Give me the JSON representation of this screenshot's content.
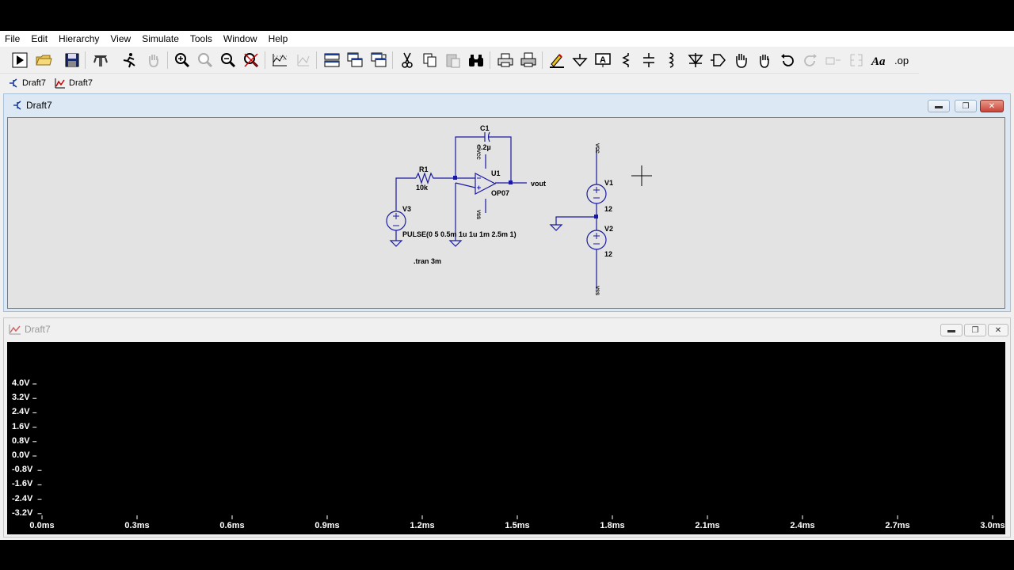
{
  "menu": [
    "File",
    "Edit",
    "Hierarchy",
    "View",
    "Simulate",
    "Tools",
    "Window",
    "Help"
  ],
  "toolbar_icons": [
    "run-icon",
    "open-icon",
    "save-icon",
    "control-panel-icon",
    "halt-icon",
    "pan-hand-icon",
    "zoom-in-icon",
    "zoom-area-icon",
    "zoom-out-icon",
    "zoom-fit-icon",
    "autorange-icon",
    "cascade-dim-icon",
    "tile-horizontal-icon",
    "cascade-icon",
    "tile-vertical-icon",
    "cut-icon",
    "copy-icon",
    "paste-icon",
    "find-icon",
    "print-icon",
    "print-setup-icon",
    "draw-wire-icon",
    "ground-icon",
    "label-net-icon",
    "resistor-icon",
    "capacitor-icon",
    "inductor-icon",
    "diode-icon",
    "component-icon",
    "move-icon",
    "drag-icon",
    "undo-icon",
    "redo-icon",
    "rotate-icon",
    "mirror-icon",
    "text-icon",
    "spice-directive-icon"
  ],
  "tabs": [
    {
      "label": "Draft7",
      "icon": "schematic-icon"
    },
    {
      "label": "Draft7",
      "icon": "waveform-icon"
    }
  ],
  "schematic_window": {
    "title": "Draft7"
  },
  "plot_window": {
    "title": "Draft7"
  },
  "schematic": {
    "c1_name": "C1",
    "c1_value": "0.2µ",
    "r1_name": "R1",
    "r1_value": "10k",
    "u1_name": "U1",
    "u1_model": "OP07",
    "vout_label": "vout",
    "v3_name": "V3",
    "v3_value": "PULSE(0 5 0.5m 1u 1u 1m 2.5m 1)",
    "v1_name": "V1",
    "v1_value": "12",
    "v2_name": "V2",
    "v2_value": "12",
    "tran_directive": ".tran 3m",
    "vcc_label": "VCC",
    "vss_label": "VSS"
  },
  "plot": {
    "y_ticks": [
      "4.0V",
      "3.2V",
      "2.4V",
      "1.6V",
      "0.8V",
      "0.0V",
      "-0.8V",
      "-1.6V",
      "-2.4V",
      "-3.2V"
    ],
    "x_ticks": [
      "0.0ms",
      "0.3ms",
      "0.6ms",
      "0.9ms",
      "1.2ms",
      "1.5ms",
      "1.8ms",
      "2.1ms",
      "2.4ms",
      "2.7ms",
      "3.0ms"
    ]
  }
}
